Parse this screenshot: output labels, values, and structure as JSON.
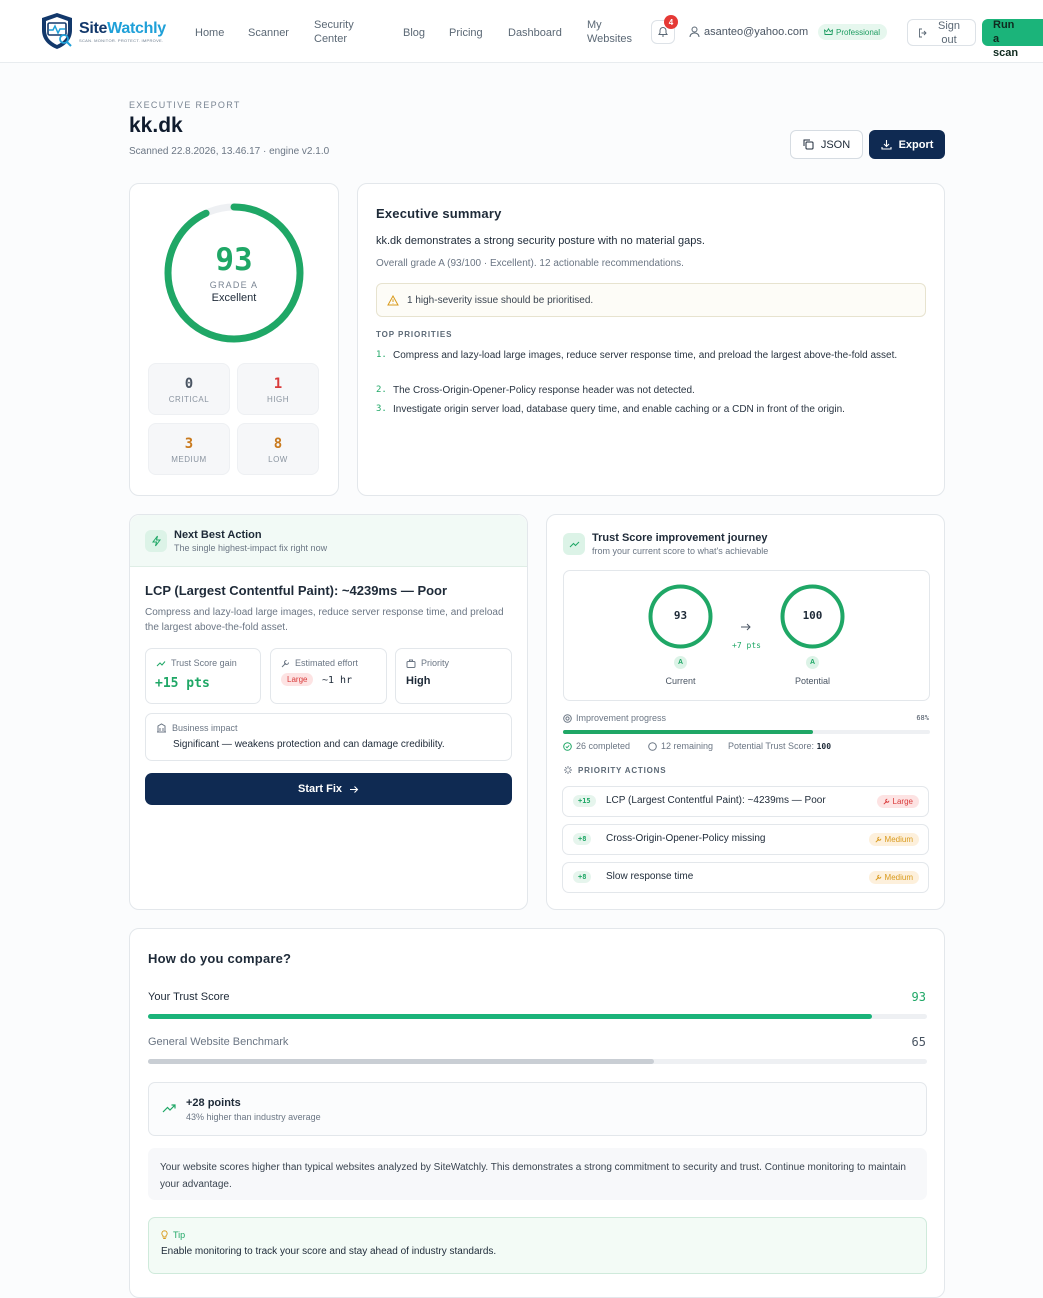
{
  "nav": {
    "logo_text_a": "Site",
    "logo_text_b": "Watchly",
    "logo_tagline": "SCAN. MONITOR. PROTECT. IMPROVE.",
    "links": [
      "Home",
      "Scanner",
      "Security Center",
      "Blog",
      "Pricing",
      "Dashboard",
      "My Websites"
    ],
    "notification_count": "4",
    "user_email": "asanteo@yahoo.com",
    "plan_badge": "Professional",
    "sign_out": "Sign out",
    "run_scan": "Run a scan"
  },
  "header": {
    "eyebrow": "EXECUTIVE REPORT",
    "domain": "kk.dk",
    "scanned": "Scanned 22.8.2026, 13.46.17 · engine v2.1.0",
    "json_button": "JSON",
    "export_button": "Export"
  },
  "score": {
    "value": 93,
    "grade": "GRADE A",
    "label": "Excellent",
    "severities": [
      {
        "count": "0",
        "label": "CRITICAL",
        "color": "#4a5563"
      },
      {
        "count": "1",
        "label": "HIGH",
        "color": "#d93b3b"
      },
      {
        "count": "3",
        "label": "MEDIUM",
        "color": "#c97a1e"
      },
      {
        "count": "8",
        "label": "LOW",
        "color": "#c97a1e"
      }
    ]
  },
  "summary": {
    "title": "Executive summary",
    "lead": "kk.dk demonstrates a strong security posture with no material gaps.",
    "sub": "Overall grade A (93/100 · Excellent). 12 actionable recommendations.",
    "alert": "1 high-severity issue should be prioritised.",
    "priorities_title": "TOP PRIORITIES",
    "priorities": [
      {
        "n": "1.",
        "text": "Compress and lazy-load large images, reduce server response time, and preload the largest above-the-fold asset."
      },
      {
        "n": "2.",
        "text": "The Cross-Origin-Opener-Policy response header was not detected."
      },
      {
        "n": "3.",
        "text": "Investigate origin server load, database query time, and enable caching or a CDN in front of the origin."
      }
    ]
  },
  "nba": {
    "title": "Next Best Action",
    "subtitle": "The single highest-impact fix right now",
    "issue": "LCP (Largest Contentful Paint): ~4239ms — Poor",
    "description": "Compress and lazy-load large images, reduce server response time, and preload the largest above-the-fold asset.",
    "gain_label": "Trust Score gain",
    "gain_value": "+15 pts",
    "effort_label": "Estimated effort",
    "effort_badge": "Large",
    "effort_value": "~1 hr",
    "priority_label": "Priority",
    "priority_value": "High",
    "impact_label": "Business impact",
    "impact_value": "Significant — weakens protection and can damage credibility.",
    "start_button": "Start Fix"
  },
  "journey": {
    "title": "Trust Score improvement journey",
    "subtitle": "from your current score to what's achievable",
    "current_value": "93",
    "current_grade": "A",
    "current_label": "Current",
    "delta": "+7 pts",
    "potential_value": "100",
    "potential_grade": "A",
    "potential_label": "Potential",
    "progress_label": "Improvement progress",
    "progress_pct_text": "68%",
    "progress": 0.68,
    "completed": "26 completed",
    "remaining": "12 remaining",
    "potential_score_label": "Potential Trust Score:",
    "potential_score_value": "100",
    "actions_title": "PRIORITY ACTIONS",
    "actions": [
      {
        "gain": "+15",
        "name": "LCP (Largest Contentful Paint): ~4239ms — Poor",
        "effort": "Large"
      },
      {
        "gain": "+8",
        "name": "Cross-Origin-Opener-Policy missing",
        "effort": "Medium"
      },
      {
        "gain": "+8",
        "name": "Slow response time",
        "effort": "Medium"
      }
    ]
  },
  "compare": {
    "title": "How do you compare?",
    "your_label": "Your Trust Score",
    "your_value": "93",
    "your_fraction": 0.93,
    "bench_label": "General Website Benchmark",
    "bench_value": "65",
    "bench_fraction": 0.65,
    "points_title": "+28 points",
    "points_sub": "43% higher than industry average",
    "paragraph": "Your website scores higher than typical websites analyzed by SiteWatchly. This demonstrates a strong commitment to security and trust. Continue monitoring to maintain your advantage.",
    "tip_label": "Tip",
    "tip_text": "Enable monitoring to track your score and stay ahead of industry standards."
  },
  "colors": {
    "accent": "#1fa766",
    "navy": "#0f2a52",
    "brand_blue": "#12386b"
  }
}
